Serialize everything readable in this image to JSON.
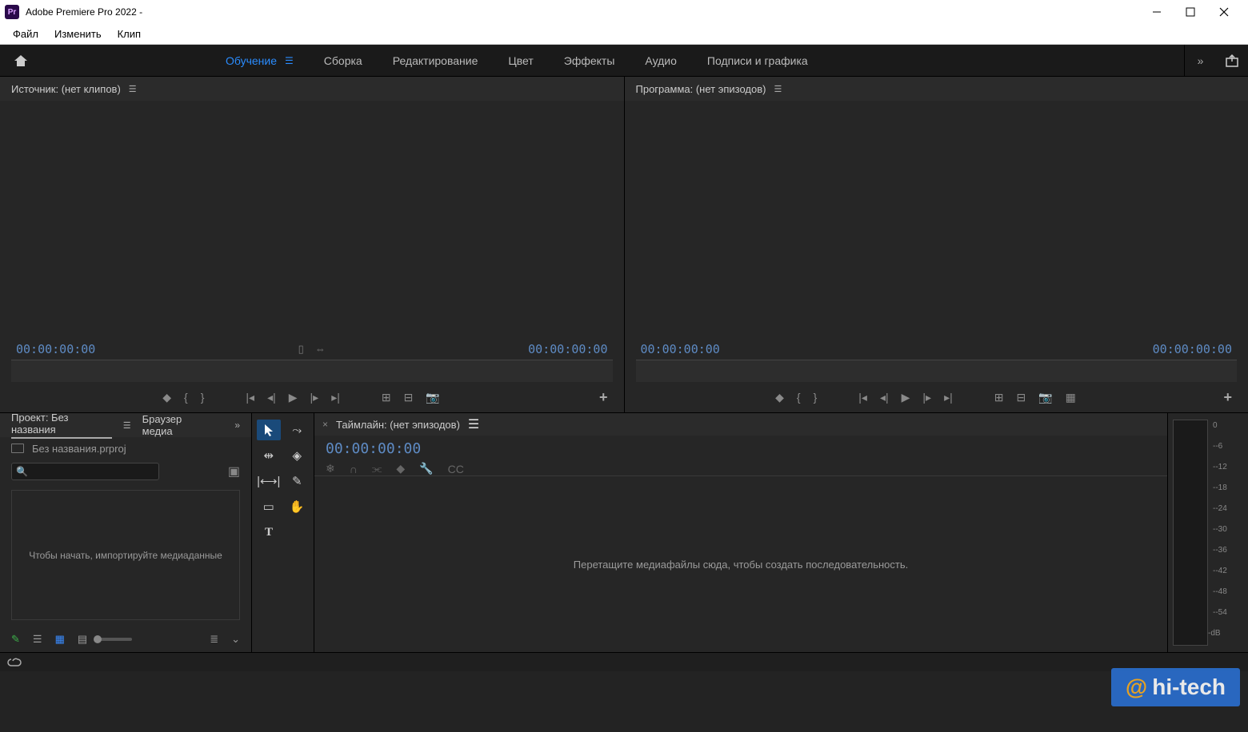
{
  "window": {
    "app_icon_text": "Pr",
    "title": "Adobe Premiere Pro 2022 -"
  },
  "menu": {
    "file": "Файл",
    "edit": "Изменить",
    "clip": "Клип"
  },
  "workspace": {
    "tabs": [
      "Обучение",
      "Сборка",
      "Редактирование",
      "Цвет",
      "Эффекты",
      "Аудио",
      "Подписи и графика"
    ],
    "active_index": 0
  },
  "source": {
    "label": "Источник: (нет клипов)",
    "tc_left": "00:00:00:00",
    "tc_right": "00:00:00:00"
  },
  "program": {
    "label": "Программа: (нет эпизодов)",
    "tc_left": "00:00:00:00",
    "tc_right": "00:00:00:00"
  },
  "project": {
    "tab_project": "Проект: Без названия",
    "tab_media": "Браузер медиа",
    "file_name": "Без названия.prproj",
    "search_placeholder": "",
    "drop_hint": "Чтобы начать, импортируйте медиаданные"
  },
  "timeline": {
    "label": "Таймлайн: (нет эпизодов)",
    "tc": "00:00:00:00",
    "drop_hint": "Перетащите медиафайлы сюда, чтобы создать последовательность."
  },
  "audio_meter": {
    "scale": [
      "0",
      "-6",
      "-12",
      "-18",
      "-24",
      "-30",
      "-36",
      "-42",
      "-48",
      "-54",
      "dB"
    ]
  },
  "watermark": {
    "at": "@",
    "text": "hi-tech"
  }
}
